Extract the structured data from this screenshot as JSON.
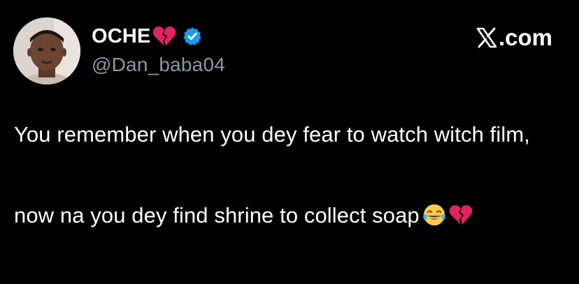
{
  "tweet": {
    "author": {
      "display_name": "OCHE",
      "name_emoji_icon": "broken-heart-icon",
      "verified_icon": "verified-badge-icon",
      "handle": "@Dan_baba04"
    },
    "brand": {
      "logo_icon": "x-logo-icon",
      "text": ".com"
    },
    "body": {
      "line1": "You remember when you dey fear to watch witch film,",
      "line2": "now na you dey find shrine to collect soap",
      "trailing_emojis": [
        "face-with-tears-of-joy-icon",
        "broken-heart-icon"
      ]
    },
    "colors": {
      "background": "#000000",
      "text": "#ffffff",
      "handle": "#8b98a5",
      "verified": "#1d9bf0",
      "broken_heart": "#e0245e"
    }
  }
}
